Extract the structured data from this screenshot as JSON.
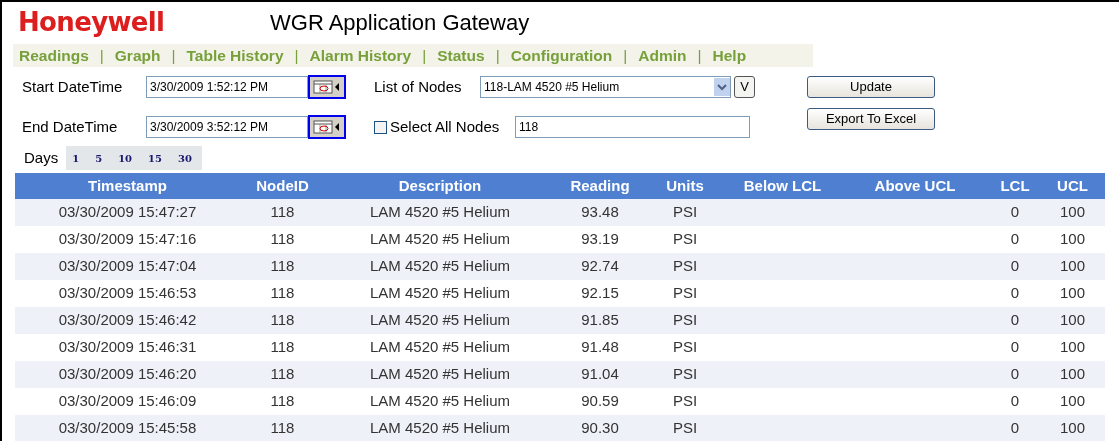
{
  "header": {
    "logo": "Honeywell",
    "title": "WGR Application Gateway"
  },
  "nav": [
    "Readings",
    "Graph",
    "Table History",
    "Alarm History",
    "Status",
    "Configuration",
    "Admin",
    "Help"
  ],
  "nav_separator": "|",
  "start": {
    "label": "Start DateTime",
    "value": "3/30/2009 1:52:12 PM"
  },
  "end": {
    "label": "End DateTime",
    "value": "3/30/2009 3:52:12 PM"
  },
  "nodes": {
    "label": "List of Nodes",
    "value": "118-LAM 4520 #5 Helium",
    "v_button": "V"
  },
  "select_all": {
    "label": "Select All Nodes",
    "checked": false,
    "value": "118"
  },
  "buttons": [
    "Update",
    "Export To Excel"
  ],
  "days": {
    "label": "Days",
    "options": [
      "1",
      "5",
      "10",
      "15",
      "30"
    ]
  },
  "table": {
    "columns": [
      "Timestamp",
      "NodeID",
      "Description",
      "Reading",
      "Units",
      "Below LCL",
      "Above UCL",
      "LCL",
      "UCL"
    ],
    "rows": [
      [
        "03/30/2009 15:47:27",
        "118",
        "LAM 4520 #5 Helium",
        "93.48",
        "PSI",
        "",
        "",
        "0",
        "100"
      ],
      [
        "03/30/2009 15:47:16",
        "118",
        "LAM 4520 #5 Helium",
        "93.19",
        "PSI",
        "",
        "",
        "0",
        "100"
      ],
      [
        "03/30/2009 15:47:04",
        "118",
        "LAM 4520 #5 Helium",
        "92.74",
        "PSI",
        "",
        "",
        "0",
        "100"
      ],
      [
        "03/30/2009 15:46:53",
        "118",
        "LAM 4520 #5 Helium",
        "92.15",
        "PSI",
        "",
        "",
        "0",
        "100"
      ],
      [
        "03/30/2009 15:46:42",
        "118",
        "LAM 4520 #5 Helium",
        "91.85",
        "PSI",
        "",
        "",
        "0",
        "100"
      ],
      [
        "03/30/2009 15:46:31",
        "118",
        "LAM 4520 #5 Helium",
        "91.48",
        "PSI",
        "",
        "",
        "0",
        "100"
      ],
      [
        "03/30/2009 15:46:20",
        "118",
        "LAM 4520 #5 Helium",
        "91.04",
        "PSI",
        "",
        "",
        "0",
        "100"
      ],
      [
        "03/30/2009 15:46:09",
        "118",
        "LAM 4520 #5 Helium",
        "90.59",
        "PSI",
        "",
        "",
        "0",
        "100"
      ],
      [
        "03/30/2009 15:45:58",
        "118",
        "LAM 4520 #5 Helium",
        "90.30",
        "PSI",
        "",
        "",
        "0",
        "100"
      ]
    ]
  }
}
